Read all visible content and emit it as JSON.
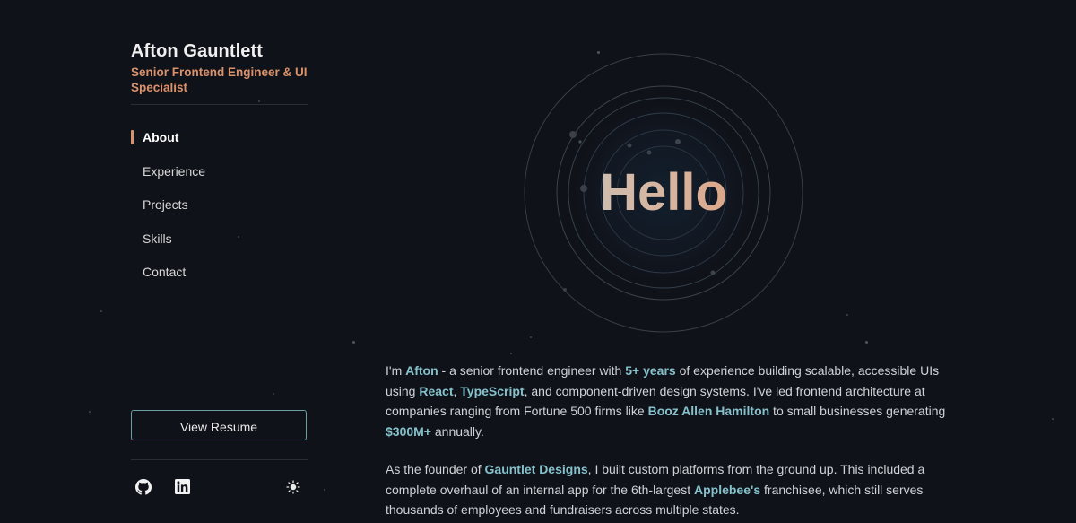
{
  "sidebar": {
    "name": "Afton Gauntlett",
    "title": "Senior Frontend Engineer & UI Specialist",
    "nav": [
      {
        "label": "About",
        "active": true
      },
      {
        "label": "Experience",
        "active": false
      },
      {
        "label": "Projects",
        "active": false
      },
      {
        "label": "Skills",
        "active": false
      },
      {
        "label": "Contact",
        "active": false
      }
    ],
    "resume_label": "View Resume",
    "icons": {
      "github": "github-icon",
      "linkedin": "linkedin-icon",
      "theme": "sun-icon"
    }
  },
  "hero": {
    "text": "Hello"
  },
  "about": {
    "p1": [
      {
        "t": "I'm "
      },
      {
        "t": "Afton",
        "hl": true
      },
      {
        "t": " - a senior frontend engineer with "
      },
      {
        "t": "5+ years",
        "hl": true
      },
      {
        "t": " of experience building scalable, accessible UIs using "
      },
      {
        "t": "React",
        "hl": true
      },
      {
        "t": ", "
      },
      {
        "t": "TypeScript",
        "hl": true
      },
      {
        "t": ", and component-driven design systems. I've led frontend architecture at companies ranging from Fortune 500 firms like "
      },
      {
        "t": "Booz Allen Hamilton",
        "hl": true
      },
      {
        "t": " to small businesses generating "
      },
      {
        "t": "$300M+",
        "hl": true
      },
      {
        "t": " annually."
      }
    ],
    "p2": [
      {
        "t": "As the founder of "
      },
      {
        "t": "Gauntlet Designs",
        "hl": true
      },
      {
        "t": ", I built custom platforms from the ground up. This included a complete overhaul of an internal app for the 6th-largest "
      },
      {
        "t": "Applebee's",
        "hl": true
      },
      {
        "t": " franchisee, which still serves thousands of employees and fundraisers across multiple states."
      }
    ]
  },
  "colors": {
    "background": "#101219",
    "accent": "#d9926c",
    "highlight": "#86c2cc",
    "button_border": "#6a9fa3"
  }
}
